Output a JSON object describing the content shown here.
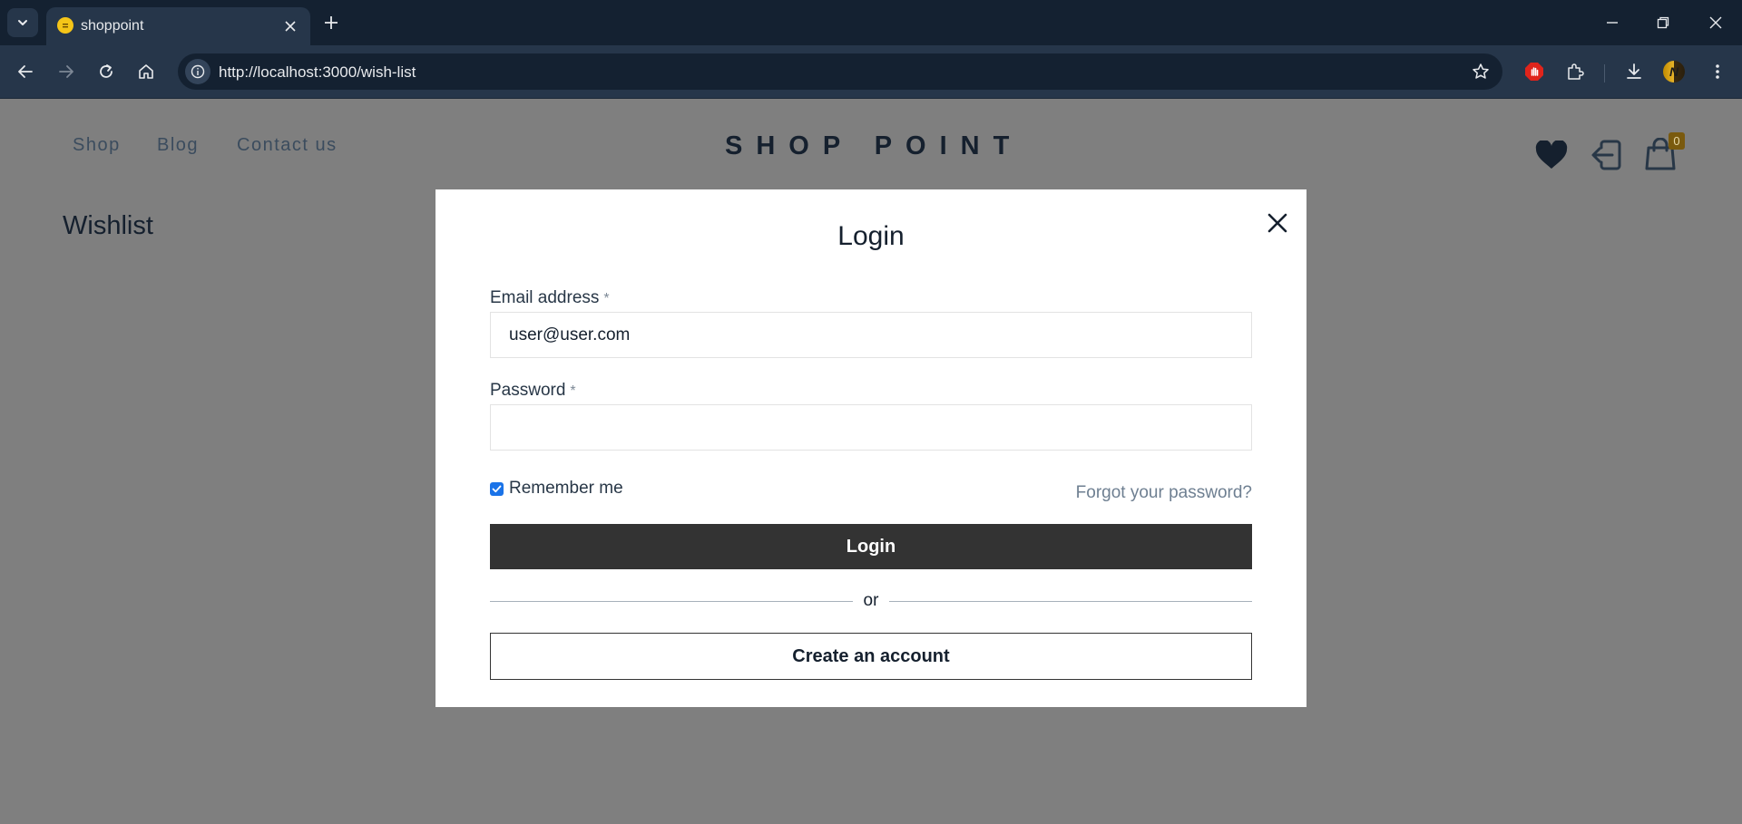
{
  "browser": {
    "tab_title": "shoppoint",
    "url": "http://localhost:3000/wish-list",
    "profile_initial": "N",
    "icons": [
      "tab-search-icon",
      "favicon",
      "close-tab-icon",
      "new-tab-icon",
      "minimize-icon",
      "restore-icon",
      "close-window-icon",
      "back-icon",
      "forward-icon",
      "reload-icon",
      "home-icon",
      "site-info-icon",
      "bookmark-star-icon",
      "adblock-extension-icon",
      "extensions-icon",
      "downloads-icon",
      "menu-icon"
    ]
  },
  "site": {
    "nav": [
      {
        "label": "Shop"
      },
      {
        "label": "Blog"
      },
      {
        "label": "Contact us"
      }
    ],
    "brand": "SHOP POINT",
    "page_title": "Wishlist",
    "cart_count": "0",
    "header_icons": [
      "heart-icon",
      "login-icon",
      "cart-icon"
    ]
  },
  "modal": {
    "title": "Login",
    "email_label": "Email address",
    "email_value": "user@user.com",
    "password_label": "Password",
    "password_value": "",
    "required_marker": "*",
    "remember_label": "Remember me",
    "remember_checked": true,
    "forgot_label": "Forgot your password?",
    "login_button": "Login",
    "divider_text": "or",
    "create_account_button": "Create an account"
  },
  "colors": {
    "overlay": "#7f7f7f",
    "modal_bg": "#ffffff",
    "primary_button": "#333333",
    "chrome_dark": "#142131",
    "chrome_mid": "#26364a",
    "checkbox_accent": "#1a73e8",
    "cart_badge": "#7a5a0e"
  }
}
